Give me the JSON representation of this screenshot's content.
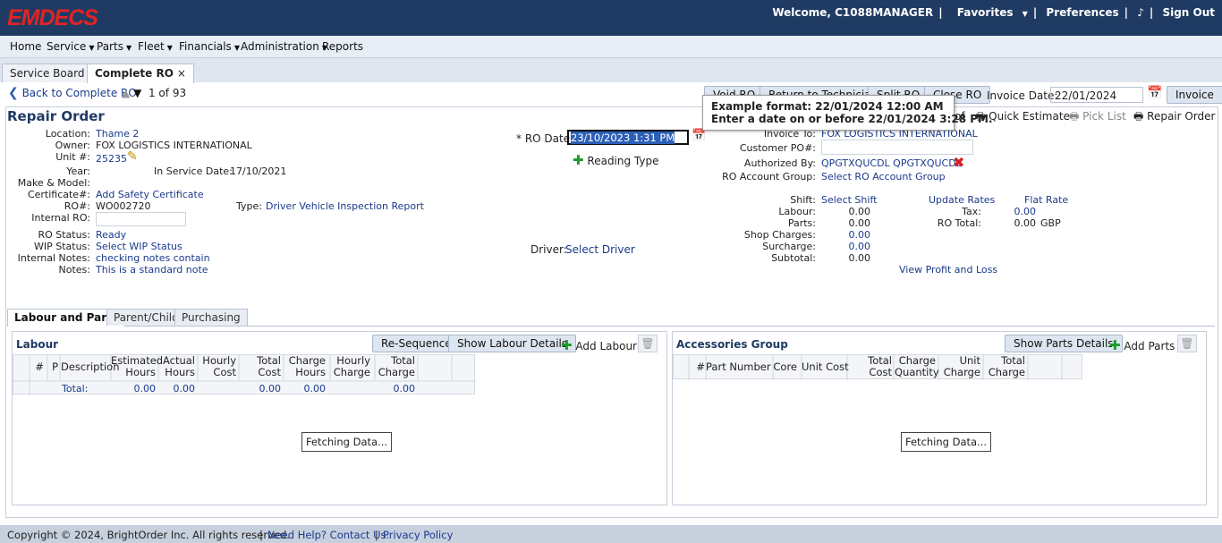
{
  "app": {
    "logo": "EMDECS"
  },
  "topnav": {
    "welcome": "Welcome, C1088MANAGER",
    "favorites": "Favorites",
    "preferences": "Preferences",
    "signout": "Sign Out"
  },
  "menu": [
    "Home",
    "Service",
    "Parts",
    "Fleet",
    "Financials",
    "Administration",
    "Reports"
  ],
  "tabs": [
    {
      "label": "Service Board"
    },
    {
      "label": "Complete RO"
    }
  ],
  "toolbar": {
    "back": "Back to Complete RO",
    "page_current": "1",
    "page_of": "of",
    "page_total": "93",
    "void": "Void RO",
    "return_tech": "Return to Technician",
    "split": "Split RO",
    "close": "Close RO",
    "invoice_date_label": "Invoice Date:",
    "invoice_date_value": "22/01/2024",
    "invoice": "Invoice",
    "profile": "of",
    "quick_estimate": "Quick Estimate",
    "pick_list": "Pick List",
    "repair_order": "Repair Order"
  },
  "tooltip": {
    "line1": "Example format: 22/01/2024 12:00 AM",
    "line2": "Enter a date on or before 22/01/2024 3:28 PM."
  },
  "ro": {
    "title": "Repair Order",
    "location_label": "Location:",
    "location": "Thame 2",
    "owner_label": "Owner:",
    "owner": "FOX LOGISTICS INTERNATIONAL",
    "unit_label": "Unit #:",
    "unit": "25235",
    "year_label": "Year:",
    "in_service_label": "In Service Date:",
    "in_service": "17/10/2021",
    "make_model_label": "Make & Model:",
    "certificate_label": "Certificate#:",
    "certificate": "Add Safety Certificate",
    "ro_no_label": "RO#:",
    "ro_no": "WO002720",
    "type_label": "Type:",
    "type": "Driver Vehicle Inspection Report",
    "internal_ro_label": "Internal RO:",
    "status_label": "RO Status:",
    "status": "Ready",
    "wip_label": "WIP Status:",
    "wip": "Select WIP Status",
    "internal_notes_label": "Internal Notes:",
    "internal_notes": "checking notes contain",
    "notes_label": "Notes:",
    "notes": "This is a standard note",
    "ro_date_label": "* RO Date:",
    "ro_date": "23/10/2023 1:31 PM",
    "reading_type": "Reading Type",
    "driver_label": "Driver:",
    "driver": "Select Driver",
    "invoice_to_label": "Invoice To:",
    "invoice_to": "FOX LOGISTICS INTERNATIONAL",
    "customer_po_label": "Customer PO#:",
    "authorized_label": "Authorized By:",
    "authorized": "QPGTXQUCDL QPGTXQUCDL",
    "account_group_label": "RO Account Group:",
    "account_group": "Select RO Account Group",
    "shift_label": "Shift:",
    "shift": "Select Shift",
    "labour_label": "Labour:",
    "labour": "0.00",
    "parts_label": "Parts:",
    "parts": "0.00",
    "shop_label": "Shop Charges:",
    "shop": "0.00",
    "surcharge_label": "Surcharge:",
    "surcharge": "0.00",
    "subtotal_label": "Subtotal:",
    "subtotal": "0.00",
    "update_rates": "Update Rates",
    "flat_rate": "Flat Rate",
    "tax_label": "Tax:",
    "tax": "0.00",
    "ro_total_label": "RO Total:",
    "ro_total": "0.00",
    "currency": "GBP",
    "profit_loss": "View Profit and Loss"
  },
  "subtabs": [
    "Labour and Parts",
    "Parent/Child",
    "Purchasing"
  ],
  "labour": {
    "title": "Labour",
    "resequence": "Re-Sequence",
    "show_details": "Show Labour Details",
    "add": "Add Labour",
    "columns": [
      "#",
      "P",
      "Description",
      "Estimated Hours",
      "Actual Hours",
      "Hourly Cost",
      "Total Cost",
      "Charge Hours",
      "Hourly Charge",
      "Total Charge"
    ],
    "total_label": "Total:",
    "totals": [
      "0.00",
      "0.00",
      "0.00",
      "0.00",
      "0.00"
    ],
    "fetching": "Fetching Data..."
  },
  "accessories": {
    "title": "Accessories Group",
    "show_details": "Show Parts Details",
    "add": "Add Parts",
    "columns": [
      "#",
      "Part Number",
      "Core",
      "Unit Cost",
      "Total Cost",
      "Charge Quantity",
      "Unit Charge",
      "Total Charge"
    ],
    "fetching": "Fetching Data..."
  },
  "footer": {
    "copyright": "Copyright © 2024, BrightOrder Inc. All rights reserved.",
    "help": "Need Help? Contact Us.",
    "privacy": "Privacy Policy"
  },
  "colors": {
    "header": "#1f3b63",
    "logo": "#e02424",
    "link": "#1a3a8c",
    "add": "#1c9a2a",
    "delete": "#d32020"
  }
}
